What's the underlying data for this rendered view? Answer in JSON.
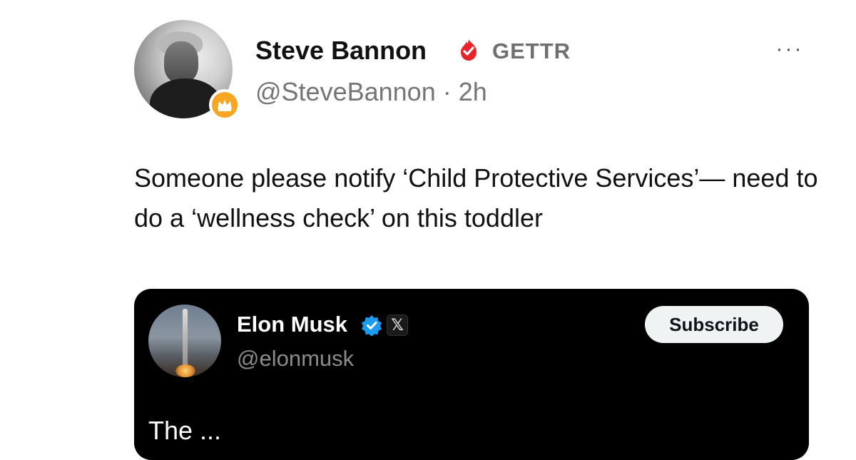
{
  "post": {
    "author": {
      "display_name": "Steve Bannon",
      "platform": "GETTR",
      "handle": "@SteveBannon",
      "separator": "·",
      "time": "2h",
      "verified_color": "#e8232a",
      "badge_color": "#f6a623"
    },
    "more_label": "···",
    "text": "Someone please notify ‘Child Protective Services’— need to do a ‘wellness check’ on this toddler"
  },
  "embed": {
    "author": {
      "display_name": "Elon Musk",
      "handle": "@elonmusk",
      "verified_color": "#1d9bf0",
      "affiliation_label": "𝕏"
    },
    "subscribe_label": "Subscribe",
    "text_partial": "The   ...   "
  },
  "icons": {
    "verified_red": "verified-flame-icon",
    "crown_badge": "crown-icon",
    "verified_blue": "verified-check-icon",
    "affiliation": "x-logo-icon",
    "more": "more-options-icon"
  }
}
